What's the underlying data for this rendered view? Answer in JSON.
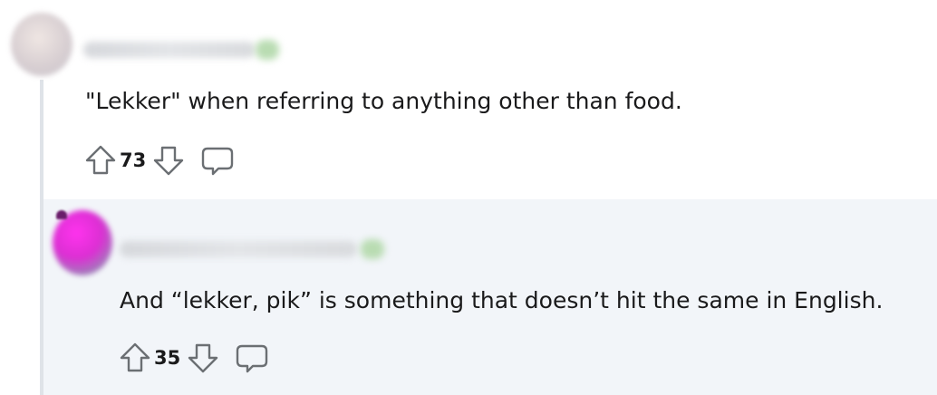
{
  "comments": [
    {
      "text": "\"Lekker\" when referring to anything other than food.",
      "score": "73",
      "avatar_icon": "user-avatar",
      "username_blurred": true
    },
    {
      "text": "And “lekker, pik” is something that doesn’t hit the same in English.",
      "score": "35",
      "avatar_icon": "user-avatar",
      "username_blurred": true
    }
  ],
  "colors": {
    "thread_line": "#dfe3e8",
    "reply_background": "#f2f5f9",
    "text": "#1a1a1b",
    "icon_stroke": "#6b6f73"
  },
  "icons": [
    "upvote-icon",
    "downvote-icon",
    "comment-icon"
  ]
}
